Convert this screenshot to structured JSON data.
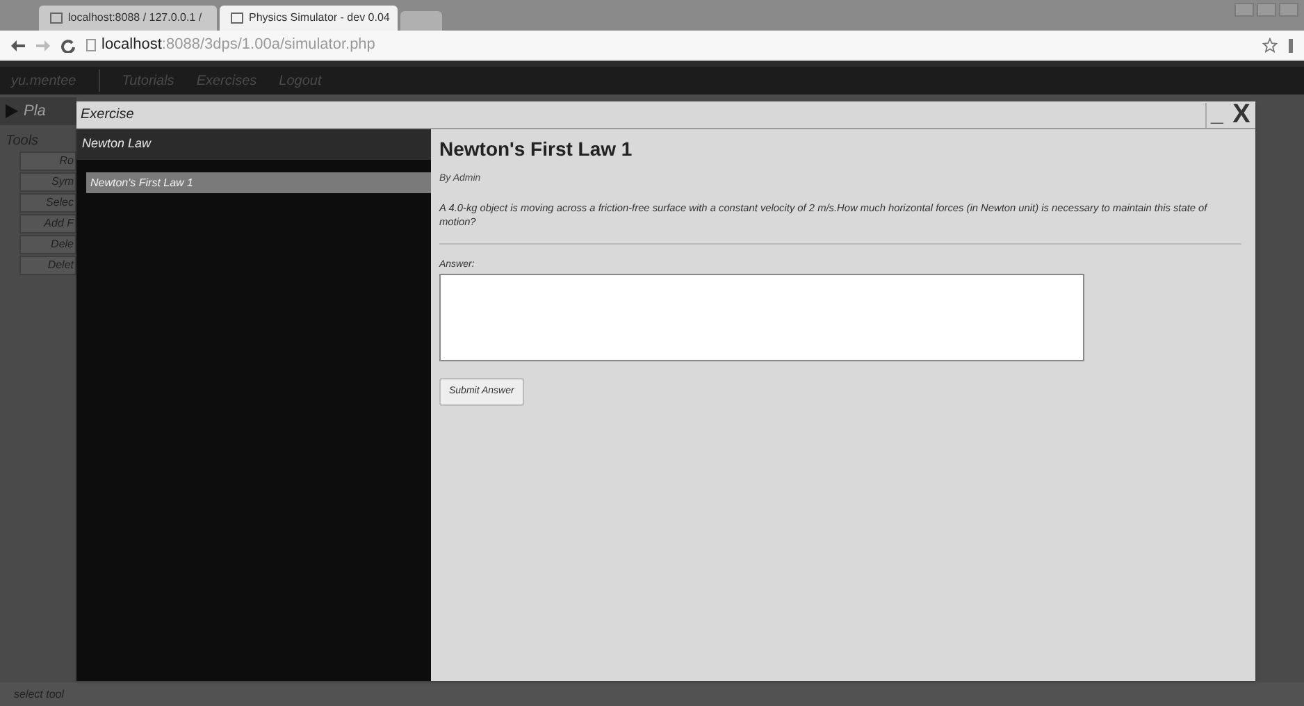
{
  "browser": {
    "tabs": [
      {
        "title": "localhost:8088 / 127.0.0.1 /",
        "selected": false
      },
      {
        "title": "Physics Simulator - dev 0.04",
        "selected": true
      }
    ],
    "address": {
      "host": "localhost",
      "path": ":8088/3dps/1.00a/simulator.php"
    }
  },
  "nav": [
    "yu.mentee",
    "Tutorials",
    "Exercises",
    "Logout"
  ],
  "app": {
    "play_label": "Pla",
    "tools_title": "Tools",
    "tools": [
      "Ro",
      "Sym",
      "Selec",
      "Add F",
      "Dele",
      "Delet"
    ],
    "status": "select tool"
  },
  "dialog": {
    "title": "Exercise",
    "minimize": "_",
    "close": "X",
    "sidebar": {
      "heading": "Newton Law",
      "items": [
        {
          "label": "Newton's First Law 1",
          "selected": true
        }
      ]
    },
    "exercise": {
      "title": "Newton's First Law 1",
      "author": "By Admin",
      "question": "A 4.0-kg object is moving across a friction-free surface with a constant velocity of 2 m/s.How much horizontal forces (in Newton unit) is necessary to maintain this state of motion?",
      "answer_label": "Answer:",
      "submit": "Submit Answer"
    }
  }
}
